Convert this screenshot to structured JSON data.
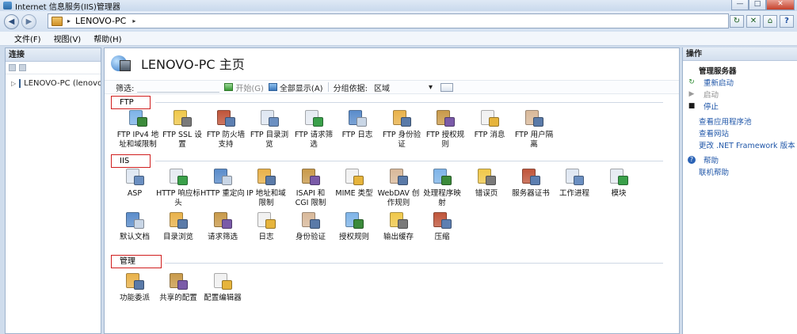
{
  "window": {
    "title": "Internet 信息服务(IIS)管理器",
    "buttons": {
      "minimize": "—",
      "maximize": "□",
      "close": "✕"
    }
  },
  "address": {
    "back": "◀",
    "forward": "▶",
    "separator": "▸",
    "path": "LENOVO-PC",
    "trailing_separator": "▸"
  },
  "toolbar_icons": [
    "refresh-icon",
    "stop-icon",
    "home-icon",
    "help-icon"
  ],
  "toolbar_glyphs": {
    "refresh": "↻",
    "stop": "✕",
    "home": "⌂",
    "help": "?"
  },
  "menu": [
    "文件(F)",
    "视图(V)",
    "帮助(H)"
  ],
  "connections": {
    "header": "连接",
    "tree": [
      {
        "label": "LENOVO-PC (lenovo",
        "expander": "▷"
      }
    ]
  },
  "main": {
    "title": "LENOVO-PC 主页",
    "filter": {
      "label": "筛选:",
      "go": "开始(G)",
      "show_all": "全部显示(A)",
      "group_by_label": "分组依据:",
      "group_by_value": "区域",
      "dropdown_arrow": "▾"
    },
    "sections": [
      {
        "label": "FTP",
        "tiles": [
          {
            "label": "FTP IPv4 地址和域限制",
            "icon": "ftp-ip-restrictions-icon"
          },
          {
            "label": "FTP SSL 设置",
            "icon": "ftp-ssl-lock-icon"
          },
          {
            "label": "FTP 防火墙支持",
            "icon": "ftp-firewall-icon"
          },
          {
            "label": "FTP 目录浏览",
            "icon": "ftp-directory-browsing-icon"
          },
          {
            "label": "FTP 请求筛选",
            "icon": "ftp-request-filtering-icon"
          },
          {
            "label": "FTP 日志",
            "icon": "ftp-logging-icon"
          },
          {
            "label": "FTP 身份验证",
            "icon": "ftp-authentication-icon"
          },
          {
            "label": "FTP 授权规则",
            "icon": "ftp-authorization-icon"
          },
          {
            "label": "FTP 消息",
            "icon": "ftp-messages-icon"
          },
          {
            "label": "FTP 用户隔离",
            "icon": "ftp-user-isolation-icon"
          }
        ]
      },
      {
        "label": "IIS",
        "tiles": [
          {
            "label": "ASP",
            "icon": "asp-icon"
          },
          {
            "label": "HTTP 响应标头",
            "icon": "http-response-headers-icon"
          },
          {
            "label": "HTTP 重定向",
            "icon": "http-redirect-icon"
          },
          {
            "label": "IP 地址和域限制",
            "icon": "ip-restrictions-icon"
          },
          {
            "label": "ISAPI 和 CGI 限制",
            "icon": "isapi-cgi-icon"
          },
          {
            "label": "MIME 类型",
            "icon": "mime-types-icon"
          },
          {
            "label": "WebDAV 创作规则",
            "icon": "webdav-icon"
          },
          {
            "label": "处理程序映射",
            "icon": "handler-mappings-icon"
          },
          {
            "label": "错误页",
            "icon": "error-pages-icon"
          },
          {
            "label": "服务器证书",
            "icon": "server-certificates-icon"
          },
          {
            "label": "工作进程",
            "icon": "worker-processes-icon"
          },
          {
            "label": "模块",
            "icon": "modules-icon"
          },
          {
            "label": "默认文档",
            "icon": "default-document-icon"
          },
          {
            "label": "目录浏览",
            "icon": "directory-browsing-icon"
          },
          {
            "label": "请求筛选",
            "icon": "request-filtering-icon"
          },
          {
            "label": "日志",
            "icon": "logging-icon"
          },
          {
            "label": "身份验证",
            "icon": "authentication-icon"
          },
          {
            "label": "授权规则",
            "icon": "authorization-rules-icon"
          },
          {
            "label": "输出缓存",
            "icon": "output-caching-icon"
          },
          {
            "label": "压缩",
            "icon": "compression-icon"
          }
        ]
      },
      {
        "label": "管理",
        "tiles": [
          {
            "label": "功能委派",
            "icon": "feature-delegation-icon"
          },
          {
            "label": "共享的配置",
            "icon": "shared-configuration-icon"
          },
          {
            "label": "配置编辑器",
            "icon": "configuration-editor-icon"
          }
        ]
      }
    ]
  },
  "actions": {
    "header": "操作",
    "items": [
      {
        "label": "管理服务器",
        "kind": "header"
      },
      {
        "label": "重新启动",
        "kind": "link",
        "icon": "restart-icon",
        "glyph": "↻"
      },
      {
        "label": "启动",
        "kind": "disabled",
        "icon": "start-icon",
        "glyph": "▶"
      },
      {
        "label": "停止",
        "kind": "link",
        "icon": "stop-icon",
        "glyph": "■"
      },
      {
        "label": "查看应用程序池",
        "kind": "link-noicon"
      },
      {
        "label": "查看网站",
        "kind": "link-noicon"
      },
      {
        "label": "更改 .NET Framework 版本",
        "kind": "link-noicon"
      },
      {
        "label": "帮助",
        "kind": "link",
        "icon": "help-icon",
        "glyph": "?"
      },
      {
        "label": "联机帮助",
        "kind": "link-noicon"
      }
    ]
  },
  "colors": {
    "section_highlight": "#d01e1e",
    "link": "#1f56a8",
    "accent": "#2d6ca8"
  }
}
